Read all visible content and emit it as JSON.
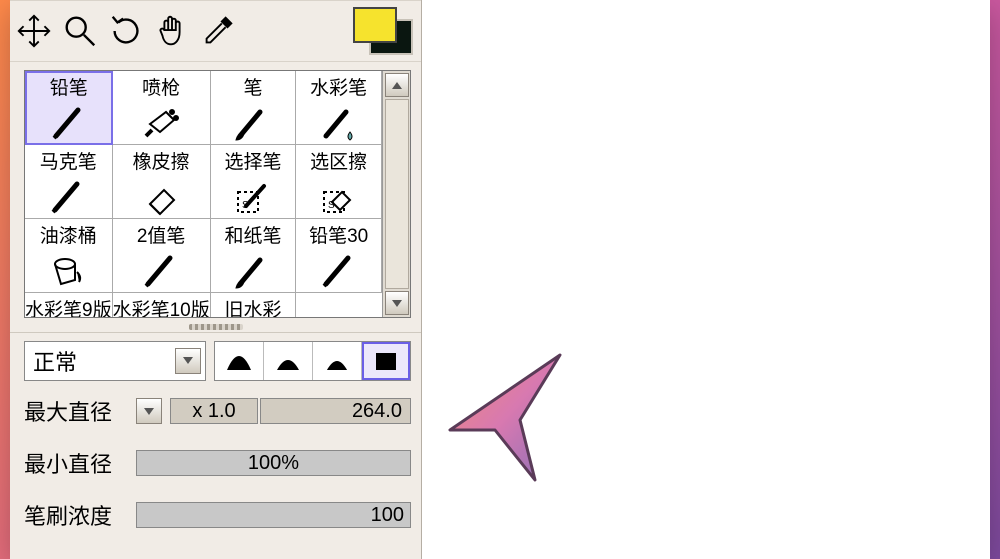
{
  "colors": {
    "fg": "#f6e32d",
    "bg": "#0a1610",
    "accent": "#7a6fe8"
  },
  "toolbar": {
    "tools": [
      {
        "name": "move-icon"
      },
      {
        "name": "zoom-icon"
      },
      {
        "name": "rotate-icon"
      },
      {
        "name": "hand-icon"
      },
      {
        "name": "eyedropper-icon"
      }
    ]
  },
  "brushes": {
    "selected_index": 0,
    "items": [
      {
        "label": "铅笔",
        "icon": "pen"
      },
      {
        "label": "喷枪",
        "icon": "airbrush"
      },
      {
        "label": "笔",
        "icon": "brush"
      },
      {
        "label": "水彩笔",
        "icon": "water"
      },
      {
        "label": "马克笔",
        "icon": "pen"
      },
      {
        "label": "橡皮擦",
        "icon": "eraser"
      },
      {
        "label": "选择笔",
        "icon": "selpen"
      },
      {
        "label": "选区擦",
        "icon": "seleraser"
      },
      {
        "label": "油漆桶",
        "icon": "bucket"
      },
      {
        "label": "2值笔",
        "icon": "pen"
      },
      {
        "label": "和纸笔",
        "icon": "brush"
      },
      {
        "label": "铅笔30",
        "icon": "pen"
      },
      {
        "label": "水彩笔9版",
        "icon": "brush"
      },
      {
        "label": "水彩笔10版",
        "icon": "brush"
      },
      {
        "label": "旧水彩",
        "icon": "brush"
      }
    ]
  },
  "blend": {
    "mode": "正常",
    "selected_shape": 3
  },
  "params": {
    "max_diameter": {
      "label": "最大直径",
      "multiplier": "x 1.0",
      "value": "264.0"
    },
    "min_diameter": {
      "label": "最小直径",
      "value": "100%",
      "fill_pct": 100
    },
    "density": {
      "label": "笔刷浓度",
      "value": "100",
      "fill_pct": 100
    }
  }
}
